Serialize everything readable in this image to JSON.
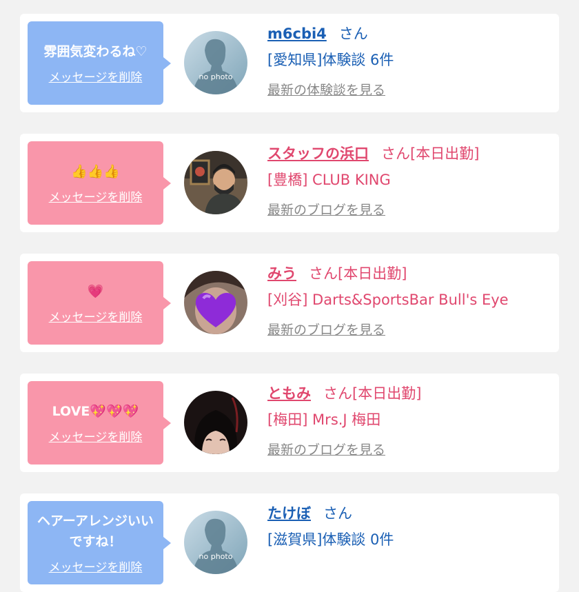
{
  "entries": [
    {
      "message": "雰囲気変わるね♡",
      "delete_label": "メッセージを削除",
      "name": "m6cbi4",
      "honorific": "さん",
      "duty": "",
      "sub_text": "[愛知県]体験談 6件",
      "link_text": "最新の体験談を見る",
      "avatar": "no-photo",
      "avatar_text": "no photo",
      "theme": "blue"
    },
    {
      "message": "👍👍👍",
      "delete_label": "メッセージを削除",
      "name": "スタッフの浜口",
      "honorific": "さん",
      "duty": "[本日出勤]",
      "sub_text": "[豊橋] CLUB KING",
      "link_text": "最新のブログを見る",
      "avatar": "photo-staff",
      "theme": "pink"
    },
    {
      "message": "💗",
      "delete_label": "メッセージを削除",
      "name": "みう",
      "honorific": "さん",
      "duty": "[本日出勤]",
      "sub_text": "[刈谷] Darts&SportsBar Bull's Eye",
      "link_text": "最新のブログを見る",
      "avatar": "photo-heart",
      "theme": "pink"
    },
    {
      "message": "LOVE💖💖💖",
      "delete_label": "メッセージを削除",
      "name": "ともみ",
      "honorific": "さん",
      "duty": "[本日出勤]",
      "sub_text": "[梅田] Mrs.J 梅田",
      "link_text": "最新のブログを見る",
      "avatar": "photo-woman",
      "theme": "pink"
    },
    {
      "message": "ヘアーアレンジいいですね！",
      "delete_label": "メッセージを削除",
      "name": "たけぼ",
      "honorific": "さん",
      "duty": "",
      "sub_text": "[滋賀県]体験談 0件",
      "link_text": "",
      "avatar": "no-photo",
      "avatar_text": "no photo",
      "theme": "blue"
    }
  ],
  "colors": {
    "bubble_blue": "#8db6f4",
    "bubble_pink": "#f996aa",
    "name_blue": "#1a5fb4",
    "name_pink": "#e0476e",
    "link_gray": "#888888"
  }
}
